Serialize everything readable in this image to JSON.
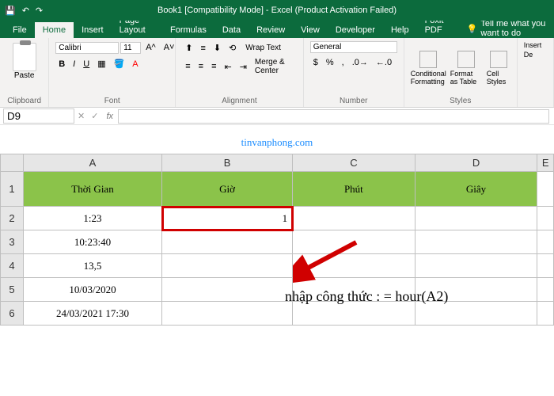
{
  "title": "Book1 [Compatibility Mode] - Excel (Product Activation Failed)",
  "tabs": {
    "file": "File",
    "home": "Home",
    "insert": "Insert",
    "layout": "Page Layout",
    "formulas": "Formulas",
    "data": "Data",
    "review": "Review",
    "view": "View",
    "developer": "Developer",
    "help": "Help",
    "foxit": "Foxit PDF",
    "tellme": "Tell me what you want to do"
  },
  "ribbon": {
    "clipboard": {
      "paste": "Paste",
      "label": "Clipboard"
    },
    "font": {
      "name": "Calibri",
      "size": "11",
      "label": "Font"
    },
    "alignment": {
      "wrap": "Wrap Text",
      "merge": "Merge & Center",
      "label": "Alignment"
    },
    "number": {
      "format": "General",
      "label": "Number"
    },
    "styles": {
      "cond": "Conditional Formatting",
      "table": "Format as Table",
      "cell": "Cell Styles",
      "label": "Styles"
    },
    "cells": {
      "insert": "Insert",
      "delete": "De"
    }
  },
  "namebox": "D9",
  "watermark": "tinvanphong.com",
  "columns": [
    "A",
    "B",
    "C",
    "D"
  ],
  "headers": {
    "a": "Thời Gian",
    "b": "Giờ",
    "c": "Phút",
    "d": "Giây"
  },
  "rows": [
    {
      "n": "1"
    },
    {
      "n": "2",
      "a": "1:23",
      "b": "1"
    },
    {
      "n": "3",
      "a": "10:23:40"
    },
    {
      "n": "4",
      "a": "13,5"
    },
    {
      "n": "5",
      "a": "10/03/2020"
    },
    {
      "n": "6",
      "a": "24/03/2021 17:30"
    }
  ],
  "annotation": "nhập công thức : = hour(A2)",
  "chart_data": {
    "type": "table",
    "columns": [
      "Thời Gian",
      "Giờ",
      "Phút",
      "Giây"
    ],
    "rows": [
      [
        "1:23",
        1,
        null,
        null
      ],
      [
        "10:23:40",
        null,
        null,
        null
      ],
      [
        "13,5",
        null,
        null,
        null
      ],
      [
        "10/03/2020",
        null,
        null,
        null
      ],
      [
        "24/03/2021 17:30",
        null,
        null,
        null
      ]
    ],
    "selected_cell": "B2",
    "formula_hint": "= hour(A2)"
  }
}
